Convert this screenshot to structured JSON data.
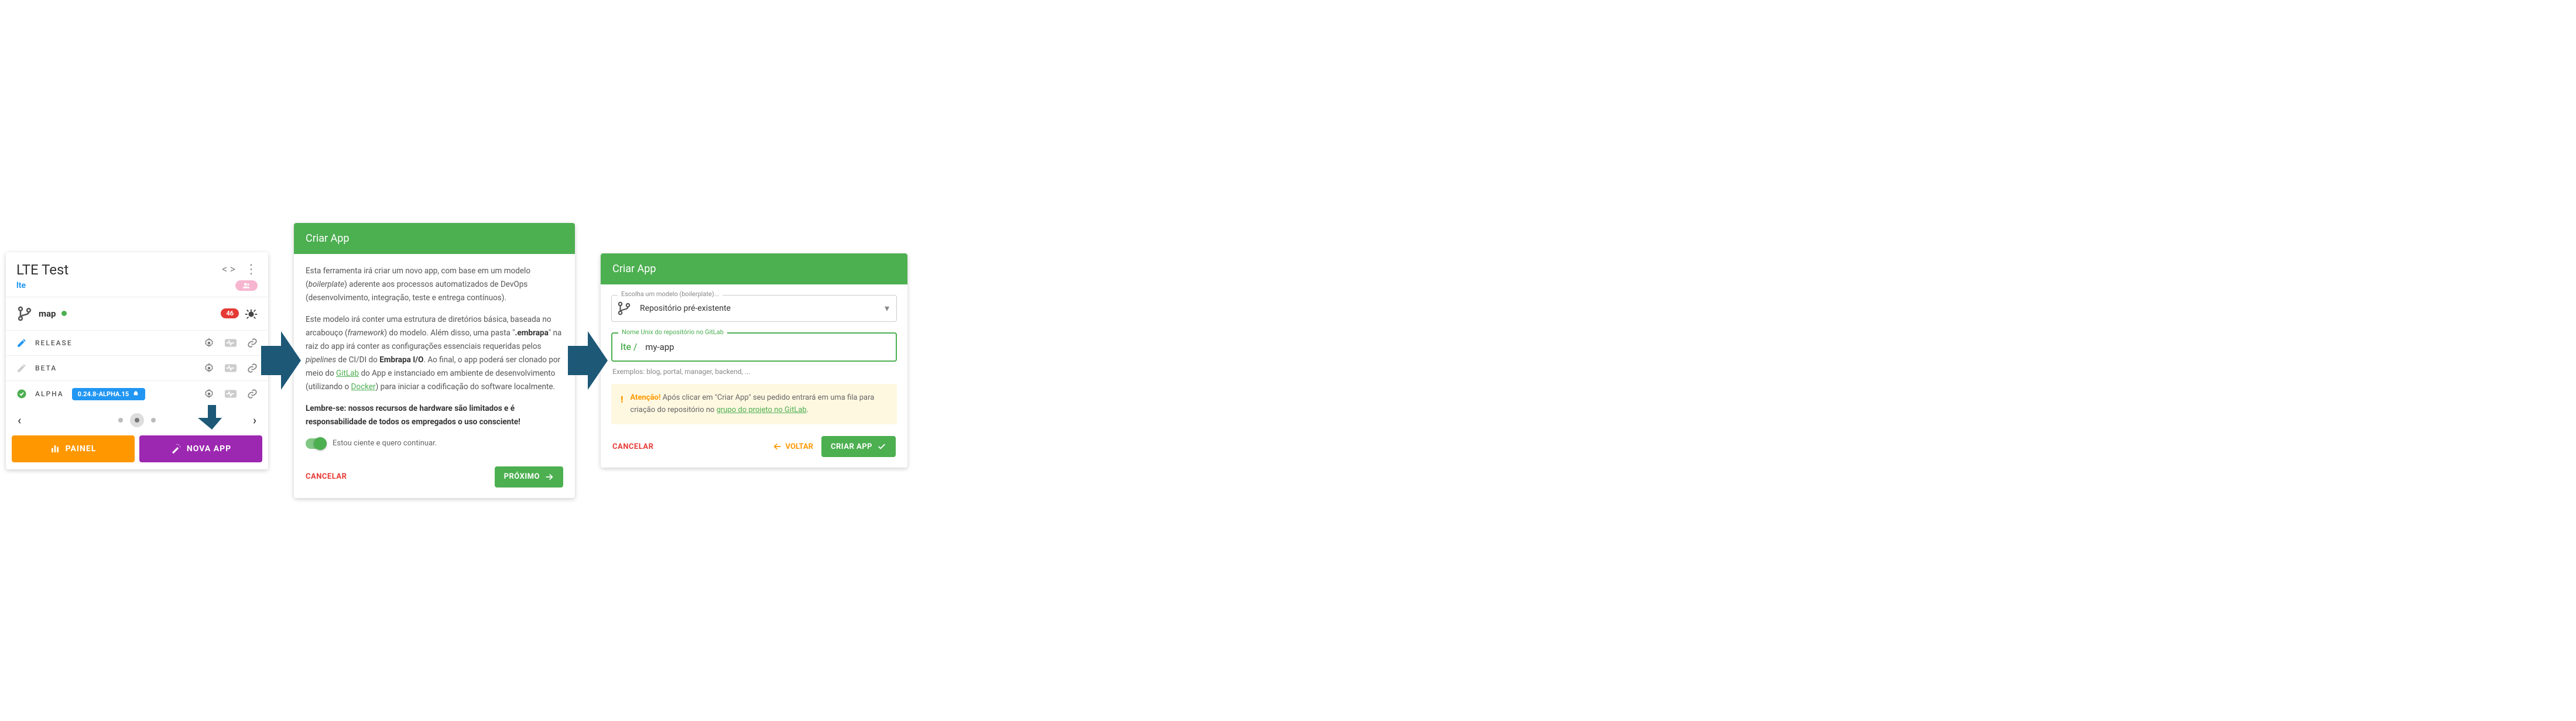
{
  "card1": {
    "title": "LTE Test",
    "subtitle": "lte",
    "branch_name": "map",
    "bug_count": "46",
    "stages": [
      {
        "label": "RELEASE",
        "chip": ""
      },
      {
        "label": "BETA",
        "chip": ""
      },
      {
        "label": "ALPHA",
        "chip": "0.24.8-ALPHA.15"
      }
    ],
    "btn_painel": "PAINEL",
    "btn_nova": "NOVA APP"
  },
  "dialog1": {
    "title": "Criar App",
    "p1a": "Esta ferramenta irá criar um novo app, com base em um modelo (",
    "p1b": "boilerplate",
    "p1c": ") aderente aos processos automatizados de DevOps (desenvolvimento, integração, teste e entrega contínuos).",
    "p2a": "Este modelo irá conter uma estrutura de diretórios básica, baseada no arcabouço (",
    "p2b": "framework",
    "p2c": ") do modelo. Além disso, uma pasta \"",
    "p2d": ".embrapa",
    "p2e": "\" na raiz do app irá conter as configurações essenciais requeridas pelos ",
    "p2f": "pipelines",
    "p2g": " de CI/DI do ",
    "p2h": "Embrapa I/O",
    "p2i": ". Ao final, o app poderá ser clonado por meio do ",
    "p2j": "GitLab",
    "p2k": " do App e instanciado em ambiente de desenvolvimento (utilizando o ",
    "p2l": "Docker",
    "p2m": ") para iniciar a codificação do software localmente.",
    "p3": "Lembre-se: nossos recursos de hardware são limitados e é responsabilidade de todos os empregados o uso consciente!",
    "toggle_label": "Estou ciente e quero continuar.",
    "cancel": "CANCELAR",
    "next": "PRÓXIMO"
  },
  "dialog2": {
    "title": "Criar App",
    "select_label": "Escolha um modelo (boilerplate)...",
    "select_value": "Repositório pré-existente",
    "input_label": "Nome Unix do repositório no GitLab",
    "input_prefix": "lte / ",
    "input_value": "my-app",
    "help": "Exemplos: blog, portal, manager, backend, ...",
    "warn_strong": "Atenção!",
    "warn_text": " Após clicar em \"Criar App\" seu pedido entrará em uma fila para criação do repositório no ",
    "warn_link": "grupo do projeto no GitLab",
    "warn_end": ".",
    "cancel": "CANCELAR",
    "back": "VOLTAR",
    "create": "CRIAR APP"
  }
}
